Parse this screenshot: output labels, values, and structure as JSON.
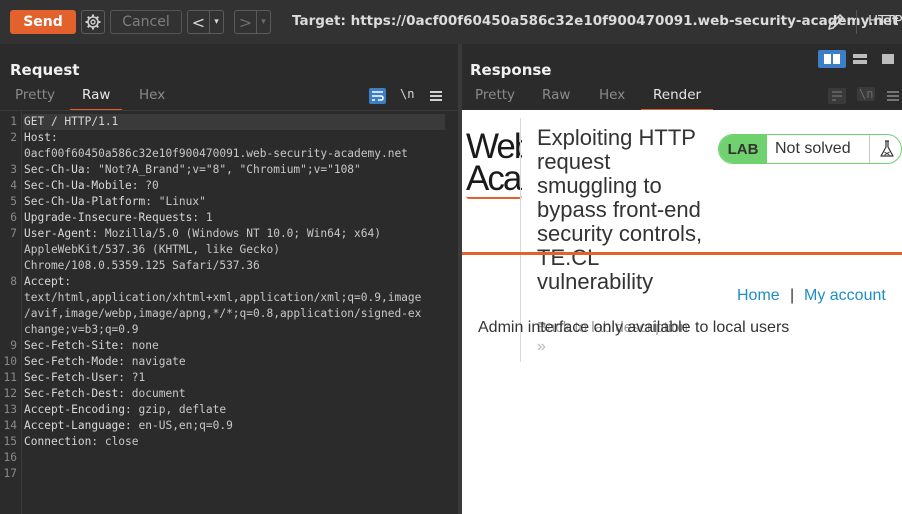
{
  "toolbar": {
    "send_label": "Send",
    "cancel_label": "Cancel",
    "back_arrow": "<",
    "forward_arrow": ">",
    "dropdown_glyph": "▾",
    "target_label": "Target: https://0acf00f60450a586c32e10f900470091.web-security-academy.net",
    "protocol_label": "HTTP",
    "icons": [
      "gear-icon",
      "pencil-icon"
    ]
  },
  "request": {
    "title": "Request",
    "tabs": [
      "Pretty",
      "Raw",
      "Hex"
    ],
    "active_tab": "Raw",
    "icons": [
      "wrap-icon",
      "newline-icon",
      "menu-icon"
    ],
    "newline_glyph": "\\n",
    "lines": [
      {
        "n": "1",
        "key": "GET / HTTP/1.1",
        "val": ""
      },
      {
        "n": "2",
        "key": "Host",
        "val": ":"
      },
      {
        "n": "",
        "key": "",
        "val": "0acf00f60450a586c32e10f900470091.web-security-academy.net"
      },
      {
        "n": "3",
        "key": "Sec-Ch-Ua",
        "val": ": \"Not?A_Brand\";v=\"8\", \"Chromium\";v=\"108\""
      },
      {
        "n": "4",
        "key": "Sec-Ch-Ua-Mobile",
        "val": ": ?0"
      },
      {
        "n": "5",
        "key": "Sec-Ch-Ua-Platform",
        "val": ": \"Linux\""
      },
      {
        "n": "6",
        "key": "Upgrade-Insecure-Requests",
        "val": ": 1"
      },
      {
        "n": "7",
        "key": "User-Agent",
        "val": ": Mozilla/5.0 (Windows NT 10.0; Win64; x64)"
      },
      {
        "n": "",
        "key": "",
        "val": "AppleWebKit/537.36 (KHTML, like Gecko)"
      },
      {
        "n": "",
        "key": "",
        "val": "Chrome/108.0.5359.125 Safari/537.36"
      },
      {
        "n": "8",
        "key": "Accept",
        "val": ":"
      },
      {
        "n": "",
        "key": "",
        "val": "text/html,application/xhtml+xml,application/xml;q=0.9,image"
      },
      {
        "n": "",
        "key": "",
        "val": "/avif,image/webp,image/apng,*/*;q=0.8,application/signed-ex"
      },
      {
        "n": "",
        "key": "",
        "val": "change;v=b3;q=0.9"
      },
      {
        "n": "9",
        "key": "Sec-Fetch-Site",
        "val": ": none"
      },
      {
        "n": "10",
        "key": "Sec-Fetch-Mode",
        "val": ": navigate"
      },
      {
        "n": "11",
        "key": "Sec-Fetch-User",
        "val": ": ?1"
      },
      {
        "n": "12",
        "key": "Sec-Fetch-Dest",
        "val": ": document"
      },
      {
        "n": "13",
        "key": "Accept-Encoding",
        "val": ": gzip, deflate"
      },
      {
        "n": "14",
        "key": "Accept-Language",
        "val": ": en-US,en;q=0.9"
      },
      {
        "n": "15",
        "key": "Connection",
        "val": ": close"
      },
      {
        "n": "16",
        "key": "",
        "val": ""
      },
      {
        "n": "17",
        "key": "",
        "val": ""
      }
    ]
  },
  "response": {
    "title": "Response",
    "tabs": [
      "Pretty",
      "Raw",
      "Hex",
      "Render"
    ],
    "active_tab": "Render",
    "layout_icons": [
      "split-horizontal-icon",
      "split-vertical-icon",
      "single-pane-icon"
    ],
    "render": {
      "logo_line1": "Web",
      "logo_line2": "Aca",
      "lab_title": "Exploiting HTTP request smuggling to bypass front-end security controls, TE.CL vulnerability",
      "badge_label": "LAB",
      "badge_status": "Not solved",
      "flask_icon": "flask-icon",
      "nav_home": "Home",
      "nav_separator": "|",
      "nav_account": "My account",
      "back_link": "Back to lab description",
      "back_chevron": "»",
      "admin_message": "Admin interface only available to local users"
    }
  },
  "colors": {
    "accent": "#e2612d",
    "lab_green": "#70d16f",
    "link_blue": "#1e8fc4",
    "toggle_blue": "#3d7ec5"
  }
}
